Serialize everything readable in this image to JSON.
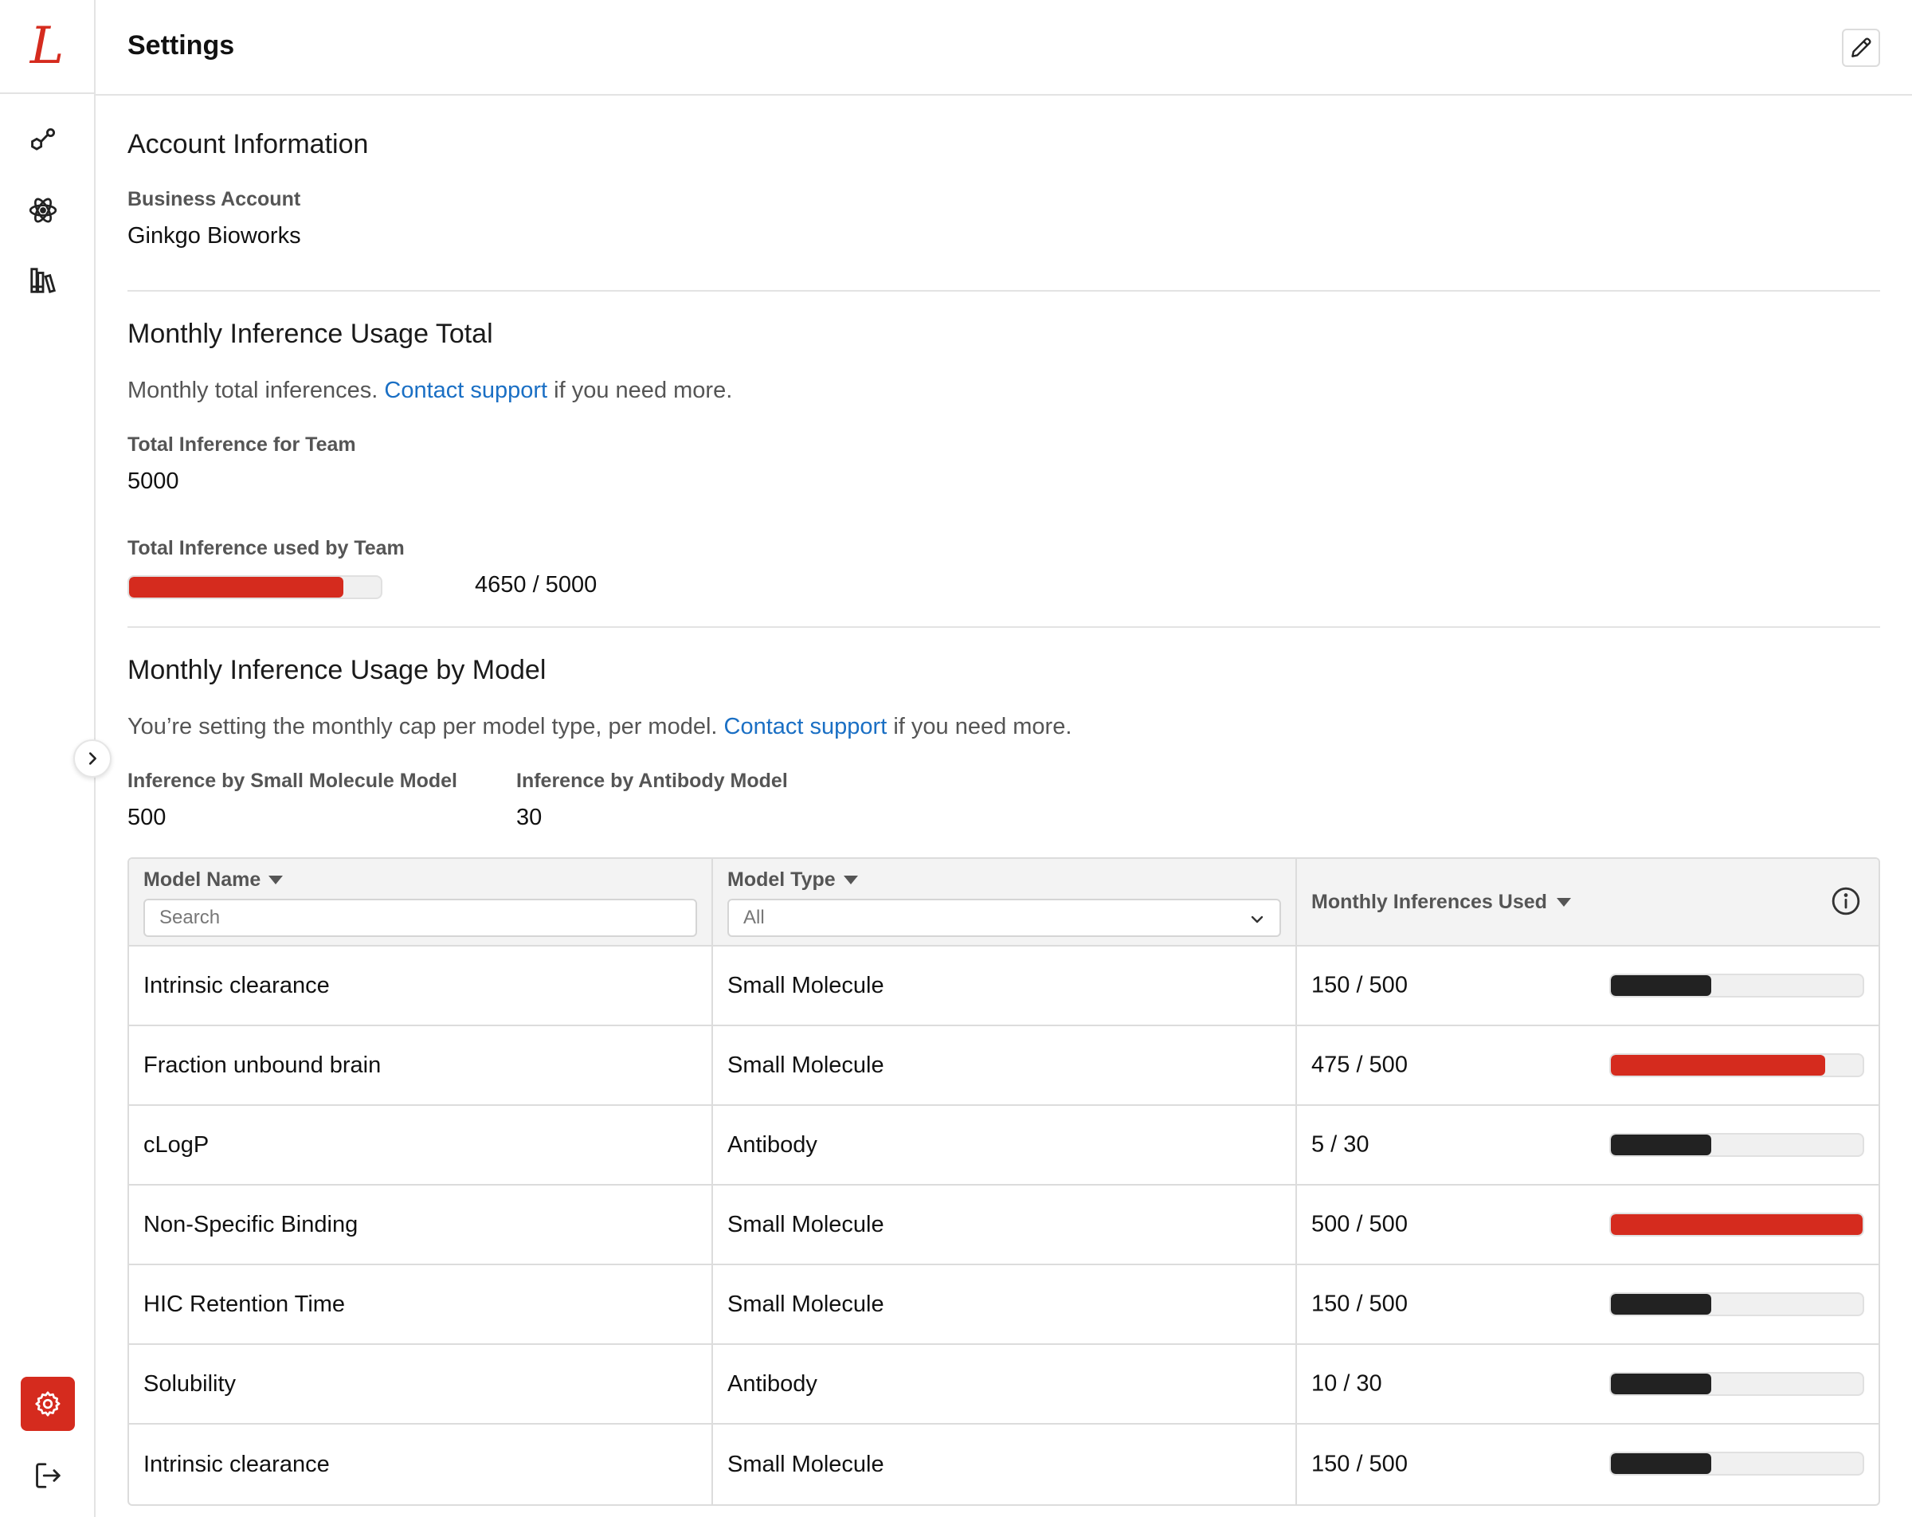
{
  "header": {
    "title": "Settings"
  },
  "sidebar": {
    "logo": "L",
    "items": [
      {
        "name": "molecules",
        "icon": "molecule-icon"
      },
      {
        "name": "models",
        "icon": "atom-icon"
      },
      {
        "name": "library",
        "icon": "library-icon"
      }
    ],
    "settings_icon": "gear-icon",
    "logout_icon": "logout-icon",
    "accent": "#d52b1e"
  },
  "account": {
    "title": "Account Information",
    "business_label": "Business Account",
    "business_value": "Ginkgo Bioworks"
  },
  "usage_total": {
    "title": "Monthly Inference Usage Total",
    "desc_before": "Monthly total inferences. ",
    "desc_link": "Contact support",
    "desc_after": " if you need more.",
    "total_label": "Total Inference for Team",
    "total_value": "5000",
    "used_label": "Total Inference used by Team",
    "used_text": "4650 / 5000",
    "used_fraction": 0.85
  },
  "usage_model": {
    "title": "Monthly Inference Usage by Model",
    "desc_before": "You’re setting the monthly cap per model type, per model. ",
    "desc_link": "Contact support",
    "desc_after": " if you need more.",
    "small_label": "Inference by Small Molecule Model",
    "small_value": "500",
    "antibody_label": "Inference by Antibody Model",
    "antibody_value": "30"
  },
  "table": {
    "col_name": "Model Name",
    "col_type": "Model Type",
    "col_usage": "Monthly Inferences Used",
    "search_placeholder": "Search",
    "type_selected": "All",
    "rows": [
      {
        "name": "Intrinsic clearance",
        "type": "Small Molecule",
        "usage": "150 / 500",
        "fraction": 0.4,
        "color": "#222222"
      },
      {
        "name": "Fraction unbound brain",
        "type": "Small Molecule",
        "usage": "475 / 500",
        "fraction": 0.85,
        "color": "#d52b1e"
      },
      {
        "name": "cLogP",
        "type": "Antibody",
        "usage": "5 / 30",
        "fraction": 0.4,
        "color": "#222222"
      },
      {
        "name": "Non-Specific Binding",
        "type": "Small Molecule",
        "usage": "500 / 500",
        "fraction": 1.0,
        "color": "#d52b1e"
      },
      {
        "name": "HIC Retention Time",
        "type": "Small Molecule",
        "usage": "150 / 500",
        "fraction": 0.4,
        "color": "#222222"
      },
      {
        "name": "Solubility",
        "type": "Antibody",
        "usage": "10 / 30",
        "fraction": 0.4,
        "color": "#222222"
      },
      {
        "name": "Intrinsic clearance",
        "type": "Small Molecule",
        "usage": "150 / 500",
        "fraction": 0.4,
        "color": "#222222"
      }
    ]
  }
}
